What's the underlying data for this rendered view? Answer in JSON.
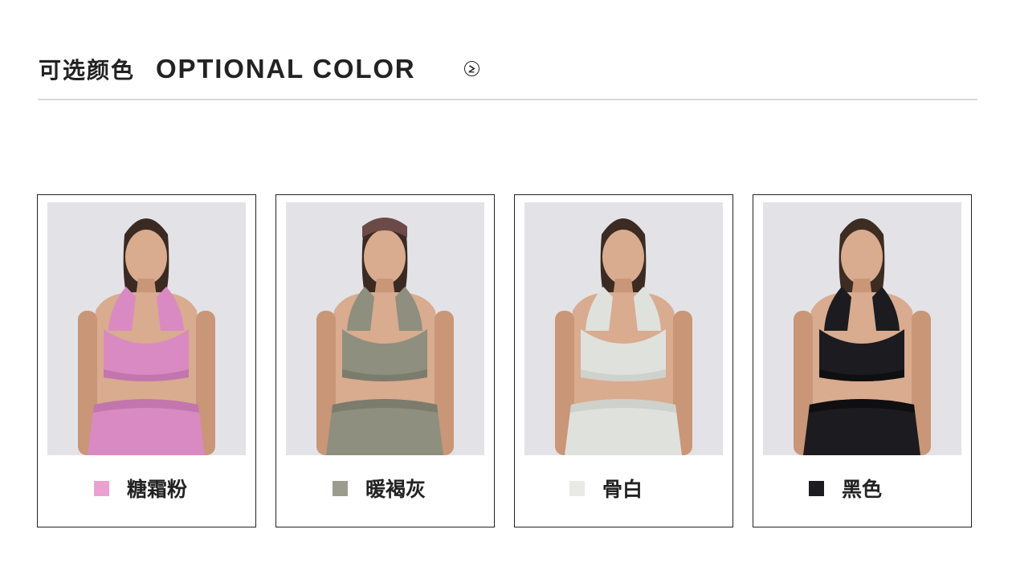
{
  "header": {
    "title_cn": "可选颜色",
    "title_en": "OPTIONAL COLOR",
    "next_icon": "circle-chevron-right-icon"
  },
  "colors": [
    {
      "label": "糖霜粉",
      "swatch": "#eaa1cf",
      "garment": "#d98ac2",
      "garment_shade": "#c276ad",
      "hair": "#3a2a22",
      "headband": null
    },
    {
      "label": "暖褐灰",
      "swatch": "#9b9c8c",
      "garment": "#8e8f7e",
      "garment_shade": "#7b7c6c",
      "hair": "#3a2a22",
      "headband": "#6b4a47"
    },
    {
      "label": "骨白",
      "swatch": "#e9e9e6",
      "garment": "#dfe1dd",
      "garment_shade": "#cfd1cc",
      "hair": "#3b2b22",
      "headband": null
    },
    {
      "label": "黑色",
      "swatch": "#1d1d21",
      "garment": "#1c1c20",
      "garment_shade": "#0f0f12",
      "hair": "#3d2c22",
      "headband": null
    }
  ]
}
